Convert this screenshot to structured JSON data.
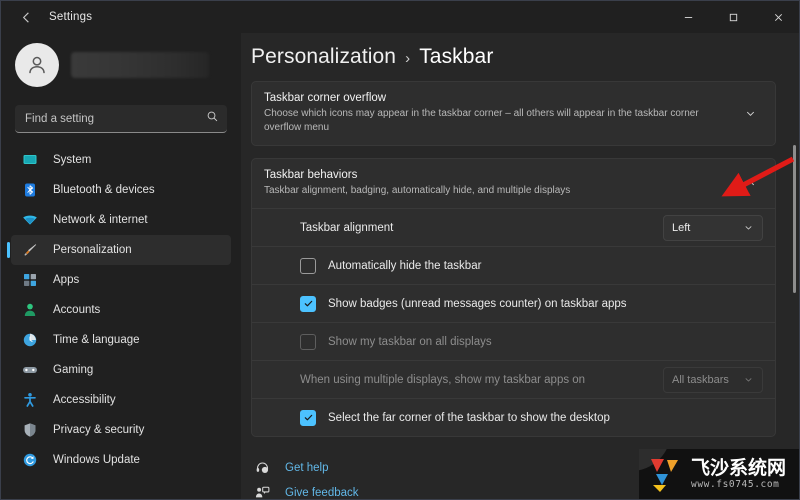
{
  "window": {
    "title": "Settings",
    "back_icon": "back-arrow-icon",
    "controls": {
      "minimize": "minimize-icon",
      "maximize": "maximize-icon",
      "close": "close-icon"
    }
  },
  "sidebar": {
    "account_name_redacted": "",
    "search": {
      "placeholder": "Find a setting",
      "value": "",
      "icon": "search-icon"
    },
    "items": [
      {
        "label": "System",
        "icon": "system-icon",
        "selected": false
      },
      {
        "label": "Bluetooth & devices",
        "icon": "bluetooth-icon",
        "selected": false
      },
      {
        "label": "Network & internet",
        "icon": "wifi-icon",
        "selected": false
      },
      {
        "label": "Personalization",
        "icon": "paintbrush-icon",
        "selected": true
      },
      {
        "label": "Apps",
        "icon": "apps-icon",
        "selected": false
      },
      {
        "label": "Accounts",
        "icon": "accounts-icon",
        "selected": false
      },
      {
        "label": "Time & language",
        "icon": "clock-icon",
        "selected": false
      },
      {
        "label": "Gaming",
        "icon": "gamepad-icon",
        "selected": false
      },
      {
        "label": "Accessibility",
        "icon": "accessibility-icon",
        "selected": false
      },
      {
        "label": "Privacy & security",
        "icon": "shield-icon",
        "selected": false
      },
      {
        "label": "Windows Update",
        "icon": "update-icon",
        "selected": false
      }
    ]
  },
  "main": {
    "breadcrumb": {
      "parent": "Personalization",
      "separator": "›",
      "current": "Taskbar"
    },
    "cards": [
      {
        "title": "Taskbar corner overflow",
        "subtitle": "Choose which icons may appear in the taskbar corner – all others will appear in the taskbar corner overflow menu",
        "expanded": false,
        "chevron": "chevron-down-icon"
      },
      {
        "title": "Taskbar behaviors",
        "subtitle": "Taskbar alignment, badging, automatically hide, and multiple displays",
        "expanded": true,
        "chevron": "chevron-up-icon"
      }
    ],
    "rows": {
      "alignment": {
        "label": "Taskbar alignment",
        "value": "Left",
        "chevron": "chevron-down-icon",
        "disabled": false
      },
      "auto_hide": {
        "label": "Automatically hide the taskbar",
        "checked": false,
        "disabled": false
      },
      "badges": {
        "label": "Show badges (unread messages counter) on taskbar apps",
        "checked": true,
        "disabled": false
      },
      "all_displays": {
        "label": "Show my taskbar on all displays",
        "checked": false,
        "disabled": true
      },
      "multi_display": {
        "label": "When using multiple displays, show my taskbar apps on",
        "value": "All taskbars",
        "chevron": "chevron-down-icon",
        "disabled": true
      },
      "far_corner": {
        "label": "Select the far corner of the taskbar to show the desktop",
        "checked": true,
        "disabled": false
      }
    },
    "links": [
      {
        "label": "Get help",
        "icon": "get-help-icon"
      },
      {
        "label": "Give feedback",
        "icon": "give-feedback-icon"
      }
    ]
  },
  "annotation": {
    "arrow_color": "#e01b17",
    "arrow_target": "taskbar-alignment-dropdown-chevron"
  },
  "watermark": {
    "name": "飞沙系统网",
    "url": "www.fs0745.com"
  },
  "colors": {
    "accent": "#4cc2ff",
    "window_bg": "#202020",
    "content_bg": "#272727",
    "card_bg": "#2e2e2e",
    "link": "#62b8e8",
    "annotation": "#e01b17"
  }
}
